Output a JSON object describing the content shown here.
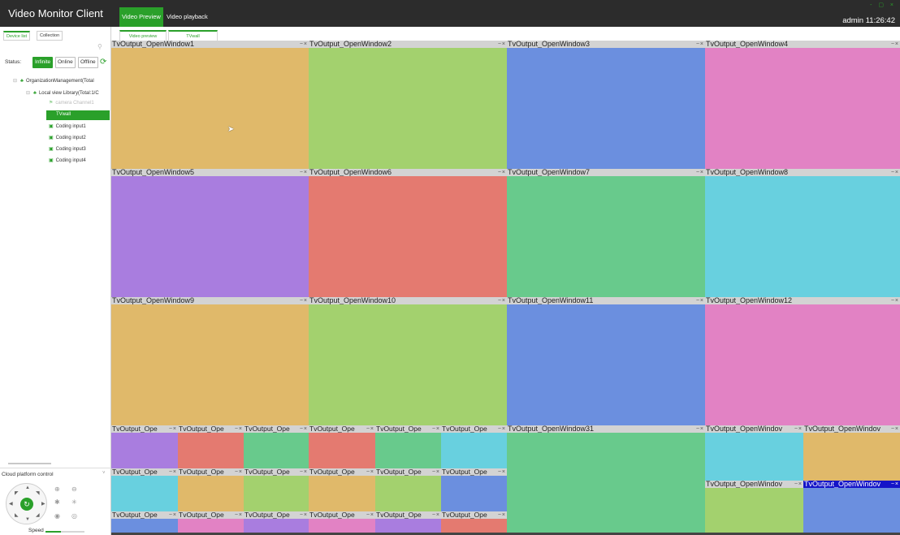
{
  "app": {
    "title": "Video Monitor Client"
  },
  "top_tabs": [
    "Video Preview",
    "Video playback"
  ],
  "window_controls": "- ▢ ×",
  "user": {
    "name": "admin",
    "time": "11:26:42"
  },
  "sidebar": {
    "tabs": [
      "Device list",
      "Collection"
    ],
    "status_label": "Status:",
    "status_buttons": [
      "Infinite",
      "Online",
      "Offline"
    ],
    "tree": [
      "OrganizationManagement(Total",
      "Local view Library(Total:1/C",
      "camera Channel1",
      "TVwall",
      "Coding input1",
      "Coding input2",
      "Coding input3",
      "Coding input4"
    ],
    "cloud_title": "Cloud platform control",
    "speed_label": "Speed",
    "speed_level": 0.4
  },
  "sub_tabs": [
    "Video preview",
    "TVwall"
  ],
  "windows": {
    "w1": "TvOutput_OpenWindow1",
    "w2": "TvOutput_OpenWindow2",
    "w3": "TvOutput_OpenWindow3",
    "w4": "TvOutput_OpenWindow4",
    "w5": "TvOutput_OpenWindow5",
    "w6": "TvOutput_OpenWindow6",
    "w7": "TvOutput_OpenWindow7",
    "w8": "TvOutput_OpenWindow8",
    "w9": "TvOutput_OpenWindow9",
    "w10": "TvOutput_OpenWindow10",
    "w11": "TvOutput_OpenWindow11",
    "w12": "TvOutput_OpenWindow12",
    "w31": "TvOutput_OpenWindow31",
    "short": "TvOutput_Ope",
    "medium": "TvOutput_OpenWindov",
    "selected": "TvOutput_OpenWindov"
  },
  "colors": {
    "accent": "#2aa02a",
    "orange": "#e0b96a",
    "green": "#a3d16e",
    "blue": "#6b8fdf",
    "pink": "#e282c4",
    "purple": "#a97ddf",
    "red": "#e47a70",
    "teal": "#68ca8c",
    "cyan": "#68d0df",
    "selected_bar": "#1515c8"
  }
}
